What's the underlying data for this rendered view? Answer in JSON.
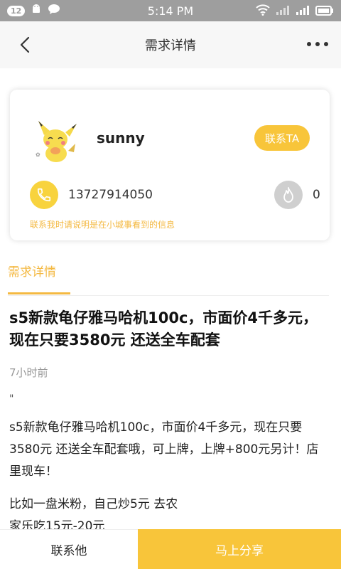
{
  "status_bar": {
    "notification_count": "12",
    "time": "5:14 PM"
  },
  "header": {
    "title": "需求详情"
  },
  "profile": {
    "username": "sunny",
    "contact_label": "联系TA",
    "phone": "13727914050",
    "fire_count": "0",
    "note": "联系我时请说明是在小城事看到的信息"
  },
  "section": {
    "tab_label": "需求详情"
  },
  "post": {
    "title": "s5新款龟仔雅马哈机100c，市面价4千多元，现在只要3580元 还送全车配套",
    "time_ago": "7小时前",
    "quote_mark": "\"",
    "body": "s5新款龟仔雅马哈机100c，市面价4千多元，现在只要3580元 还送全车配套哦，可上牌，上牌+800元另计！店里现车！",
    "body2": "比如一盘米粉，自己炒5元 去农家乐吃15元-20元"
  },
  "bottom_bar": {
    "contact_label": "联系他",
    "share_label": "马上分享"
  },
  "colors": {
    "accent": "#f8c53a",
    "note_text": "#f4b942",
    "status_bar": "#9e9e9e"
  }
}
